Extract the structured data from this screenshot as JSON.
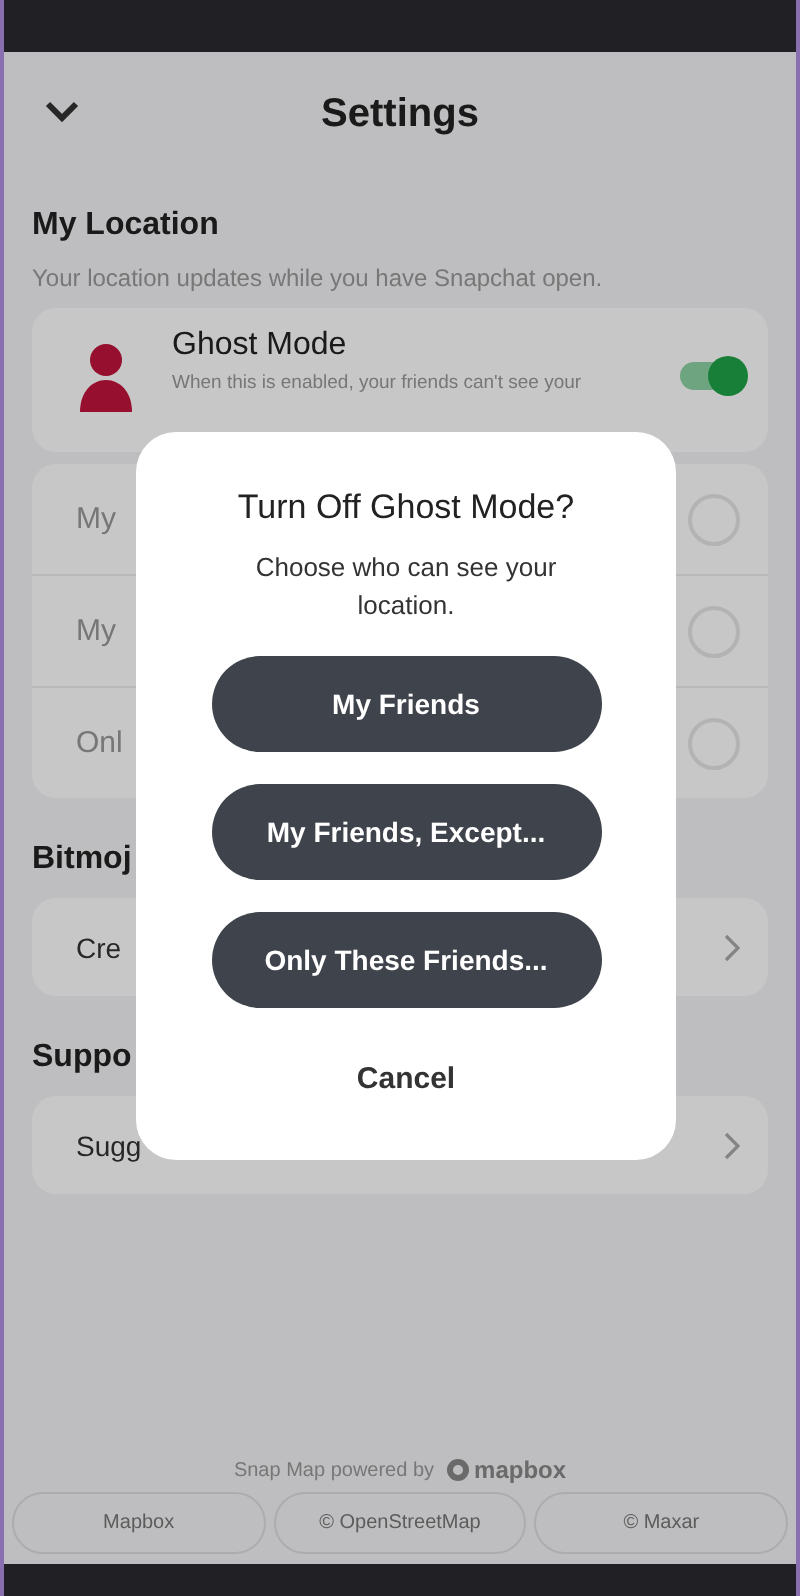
{
  "header": {
    "title": "Settings"
  },
  "location": {
    "heading": "My Location",
    "note": "Your location updates while you have Snapchat open.",
    "ghost": {
      "title": "Ghost Mode",
      "description": "When this is enabled, your friends can't see your",
      "on": true
    },
    "options": [
      {
        "label": "My",
        "selected": false
      },
      {
        "label": "My",
        "selected": false
      },
      {
        "label": "Onl",
        "selected": false
      }
    ]
  },
  "sections": [
    {
      "heading": "Bitmoj",
      "item": "Cre"
    },
    {
      "heading": "Suppo",
      "item": "Sugg"
    }
  ],
  "footer": {
    "credit": "Snap Map powered by",
    "logo": "mapbox",
    "buttons": [
      "Mapbox",
      "© OpenStreetMap",
      "© Maxar"
    ]
  },
  "dialog": {
    "title": "Turn Off Ghost Mode?",
    "message": "Choose who can see your location.",
    "buttons": [
      "My Friends",
      "My Friends, Except...",
      "Only These Friends..."
    ],
    "cancel": "Cancel"
  }
}
